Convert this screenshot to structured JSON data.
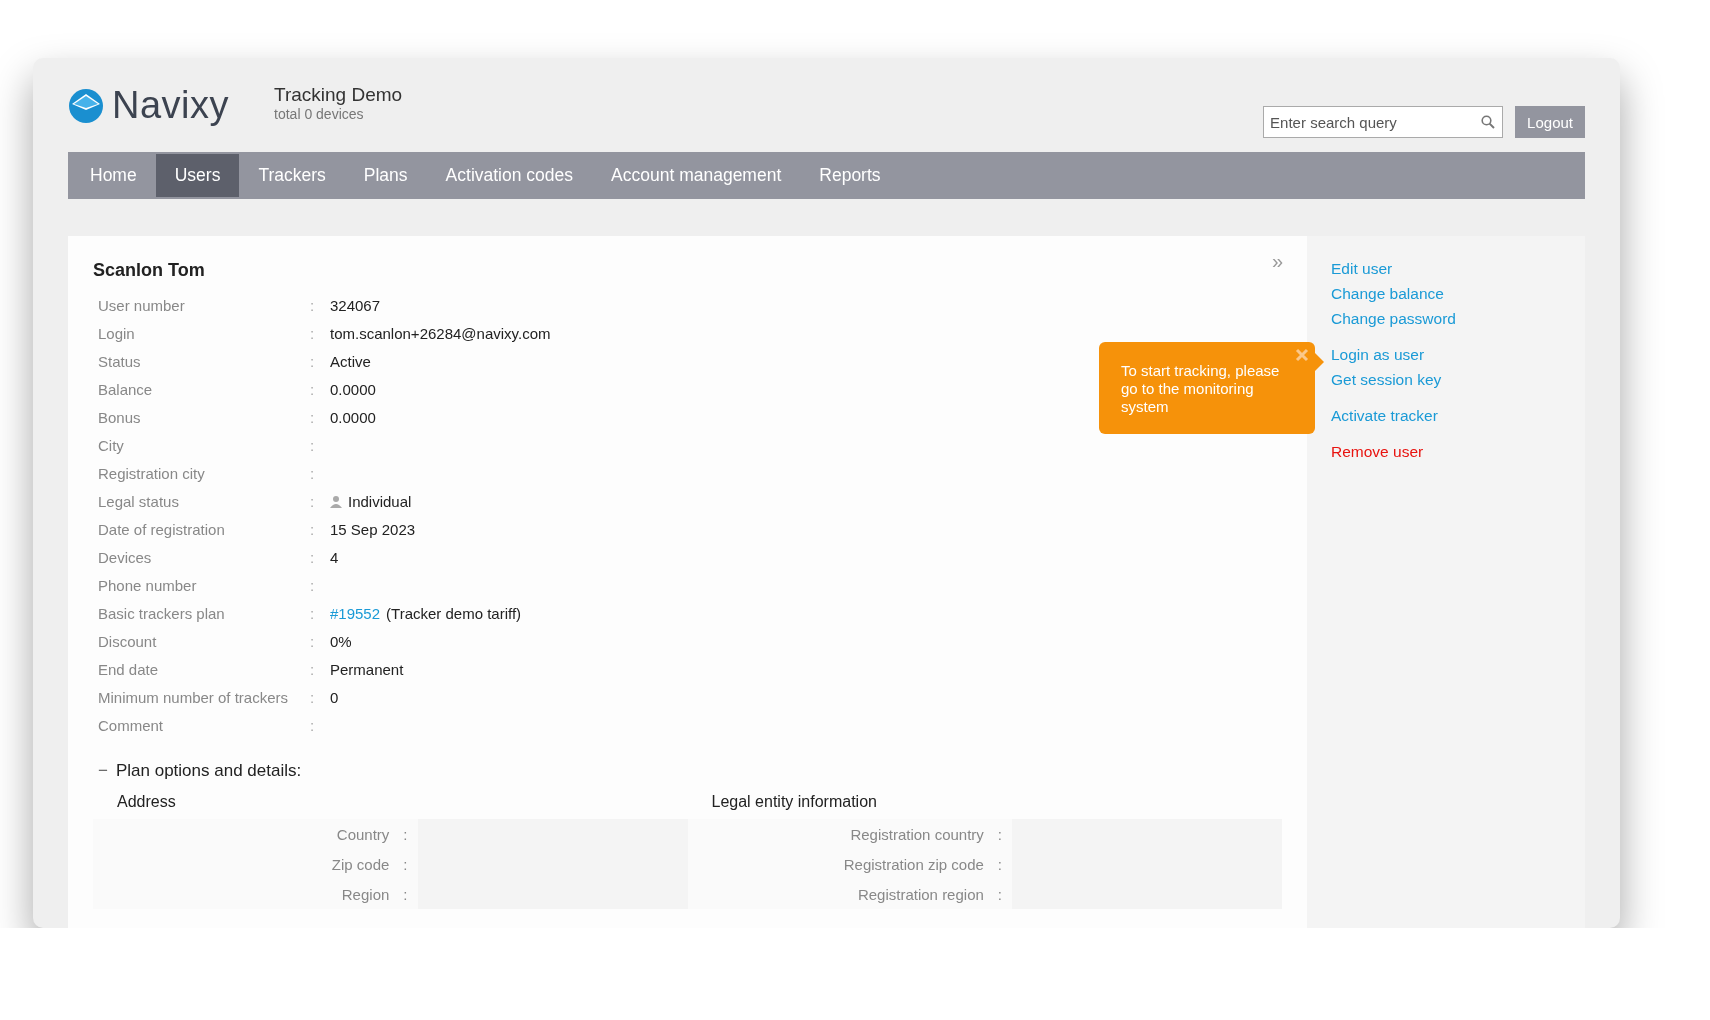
{
  "brand": {
    "name": "Navixy"
  },
  "header": {
    "title": "Tracking Demo",
    "subtitle": "total 0 devices"
  },
  "search": {
    "placeholder": "Enter search query"
  },
  "logout": "Logout",
  "nav": [
    {
      "label": "Home",
      "selected": false
    },
    {
      "label": "Users",
      "selected": true
    },
    {
      "label": "Trackers",
      "selected": false
    },
    {
      "label": "Plans",
      "selected": false
    },
    {
      "label": "Activation codes",
      "selected": false
    },
    {
      "label": "Account management",
      "selected": false
    },
    {
      "label": "Reports",
      "selected": false
    }
  ],
  "user": {
    "name": "Scanlon Tom",
    "collapse": "»",
    "separator": ":",
    "fields": [
      {
        "label": "User number",
        "kind": "text",
        "value": "324067"
      },
      {
        "label": "Login",
        "kind": "text",
        "value": "tom.scanlon+26284@navixy.com"
      },
      {
        "label": "Status",
        "kind": "text",
        "value": "Active"
      },
      {
        "label": "Balance",
        "kind": "text",
        "value": "0.0000"
      },
      {
        "label": "Bonus",
        "kind": "text",
        "value": "0.0000"
      },
      {
        "label": "City",
        "kind": "text"
      },
      {
        "label": "Registration city",
        "kind": "text"
      },
      {
        "label": "Legal status",
        "kind": "person",
        "value": "Individual"
      },
      {
        "label": "Date of registration",
        "kind": "text",
        "value": "15 Sep 2023"
      },
      {
        "label": "Devices",
        "kind": "text",
        "value": "4"
      },
      {
        "label": "Phone number",
        "kind": "text"
      },
      {
        "label": "Basic trackers plan",
        "kind": "link",
        "link": "#19552",
        "value": "(Tracker demo tariff)"
      },
      {
        "label": "Discount",
        "kind": "text",
        "value": "0%"
      },
      {
        "label": "End date",
        "kind": "text",
        "value": "Permanent"
      },
      {
        "label": "Minimum number of trackers",
        "kind": "text",
        "value": "0"
      },
      {
        "label": "Comment",
        "kind": "text"
      }
    ]
  },
  "plan_section": {
    "toggle": "−",
    "title": "Plan options and details:",
    "separator": ":",
    "columns": [
      {
        "title": "Address",
        "rows": [
          "Country",
          "Zip code",
          "Region"
        ]
      },
      {
        "title": "Legal entity information",
        "rows": [
          "Registration country",
          "Registration zip code",
          "Registration region"
        ]
      }
    ]
  },
  "tooltip": {
    "text": "To start tracking, please go to the monitoring system"
  },
  "actions": [
    [
      {
        "label": "Edit user",
        "kind": "link"
      },
      {
        "label": "Change balance",
        "kind": "link"
      },
      {
        "label": "Change password",
        "kind": "link"
      }
    ],
    [
      {
        "label": "Login as user",
        "kind": "link"
      },
      {
        "label": "Get session key",
        "kind": "link"
      }
    ],
    [
      {
        "label": "Activate tracker",
        "kind": "link"
      }
    ],
    [
      {
        "label": "Remove user",
        "kind": "danger"
      }
    ]
  ]
}
